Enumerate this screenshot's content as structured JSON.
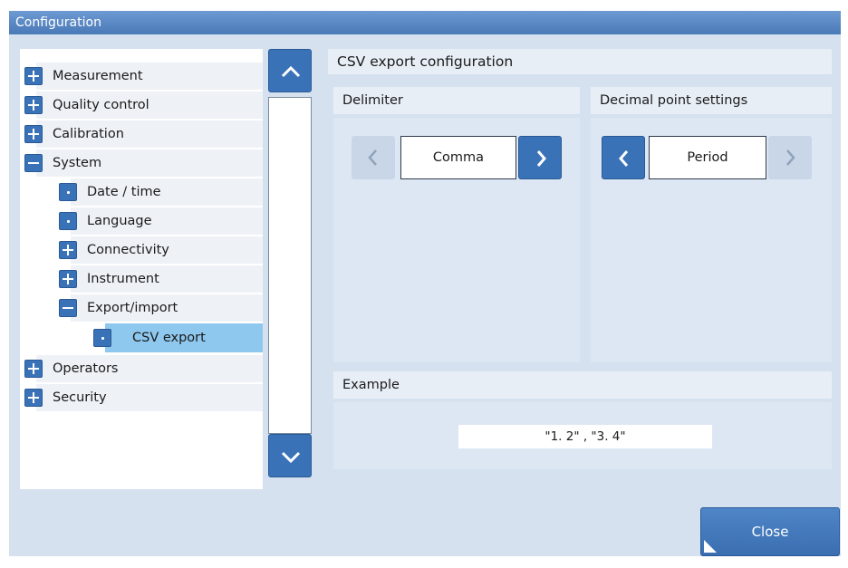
{
  "window": {
    "title": "Configuration"
  },
  "tree": {
    "items": [
      {
        "label": "Measurement",
        "icon": "plus-icon"
      },
      {
        "label": "Quality control",
        "icon": "plus-icon"
      },
      {
        "label": "Calibration",
        "icon": "plus-icon"
      },
      {
        "label": "System",
        "icon": "minus-icon"
      },
      {
        "label": "Date / time",
        "icon": "bullet-icon"
      },
      {
        "label": "Language",
        "icon": "bullet-icon"
      },
      {
        "label": "Connectivity",
        "icon": "plus-icon"
      },
      {
        "label": "Instrument",
        "icon": "plus-icon"
      },
      {
        "label": "Export/import",
        "icon": "minus-icon"
      },
      {
        "label": "CSV export",
        "icon": "bullet-icon",
        "selected": true
      },
      {
        "label": "Operators",
        "icon": "plus-icon"
      },
      {
        "label": "Security",
        "icon": "plus-icon"
      }
    ]
  },
  "scrollbar": {
    "up_icon": "chevron-up-icon",
    "down_icon": "chevron-down-icon"
  },
  "panel": {
    "title": "CSV export configuration",
    "delimiter": {
      "header": "Delimiter",
      "value": "Comma"
    },
    "decimal": {
      "header": "Decimal point settings",
      "value": "Period"
    },
    "example": {
      "header": "Example",
      "value": "\"1. 2\" , \"3. 4\""
    }
  },
  "footer": {
    "close_label": "Close"
  },
  "colors": {
    "accent": "#3a72b8",
    "selected_row": "#8ec8ee",
    "window_bg": "#d5e1ef"
  }
}
